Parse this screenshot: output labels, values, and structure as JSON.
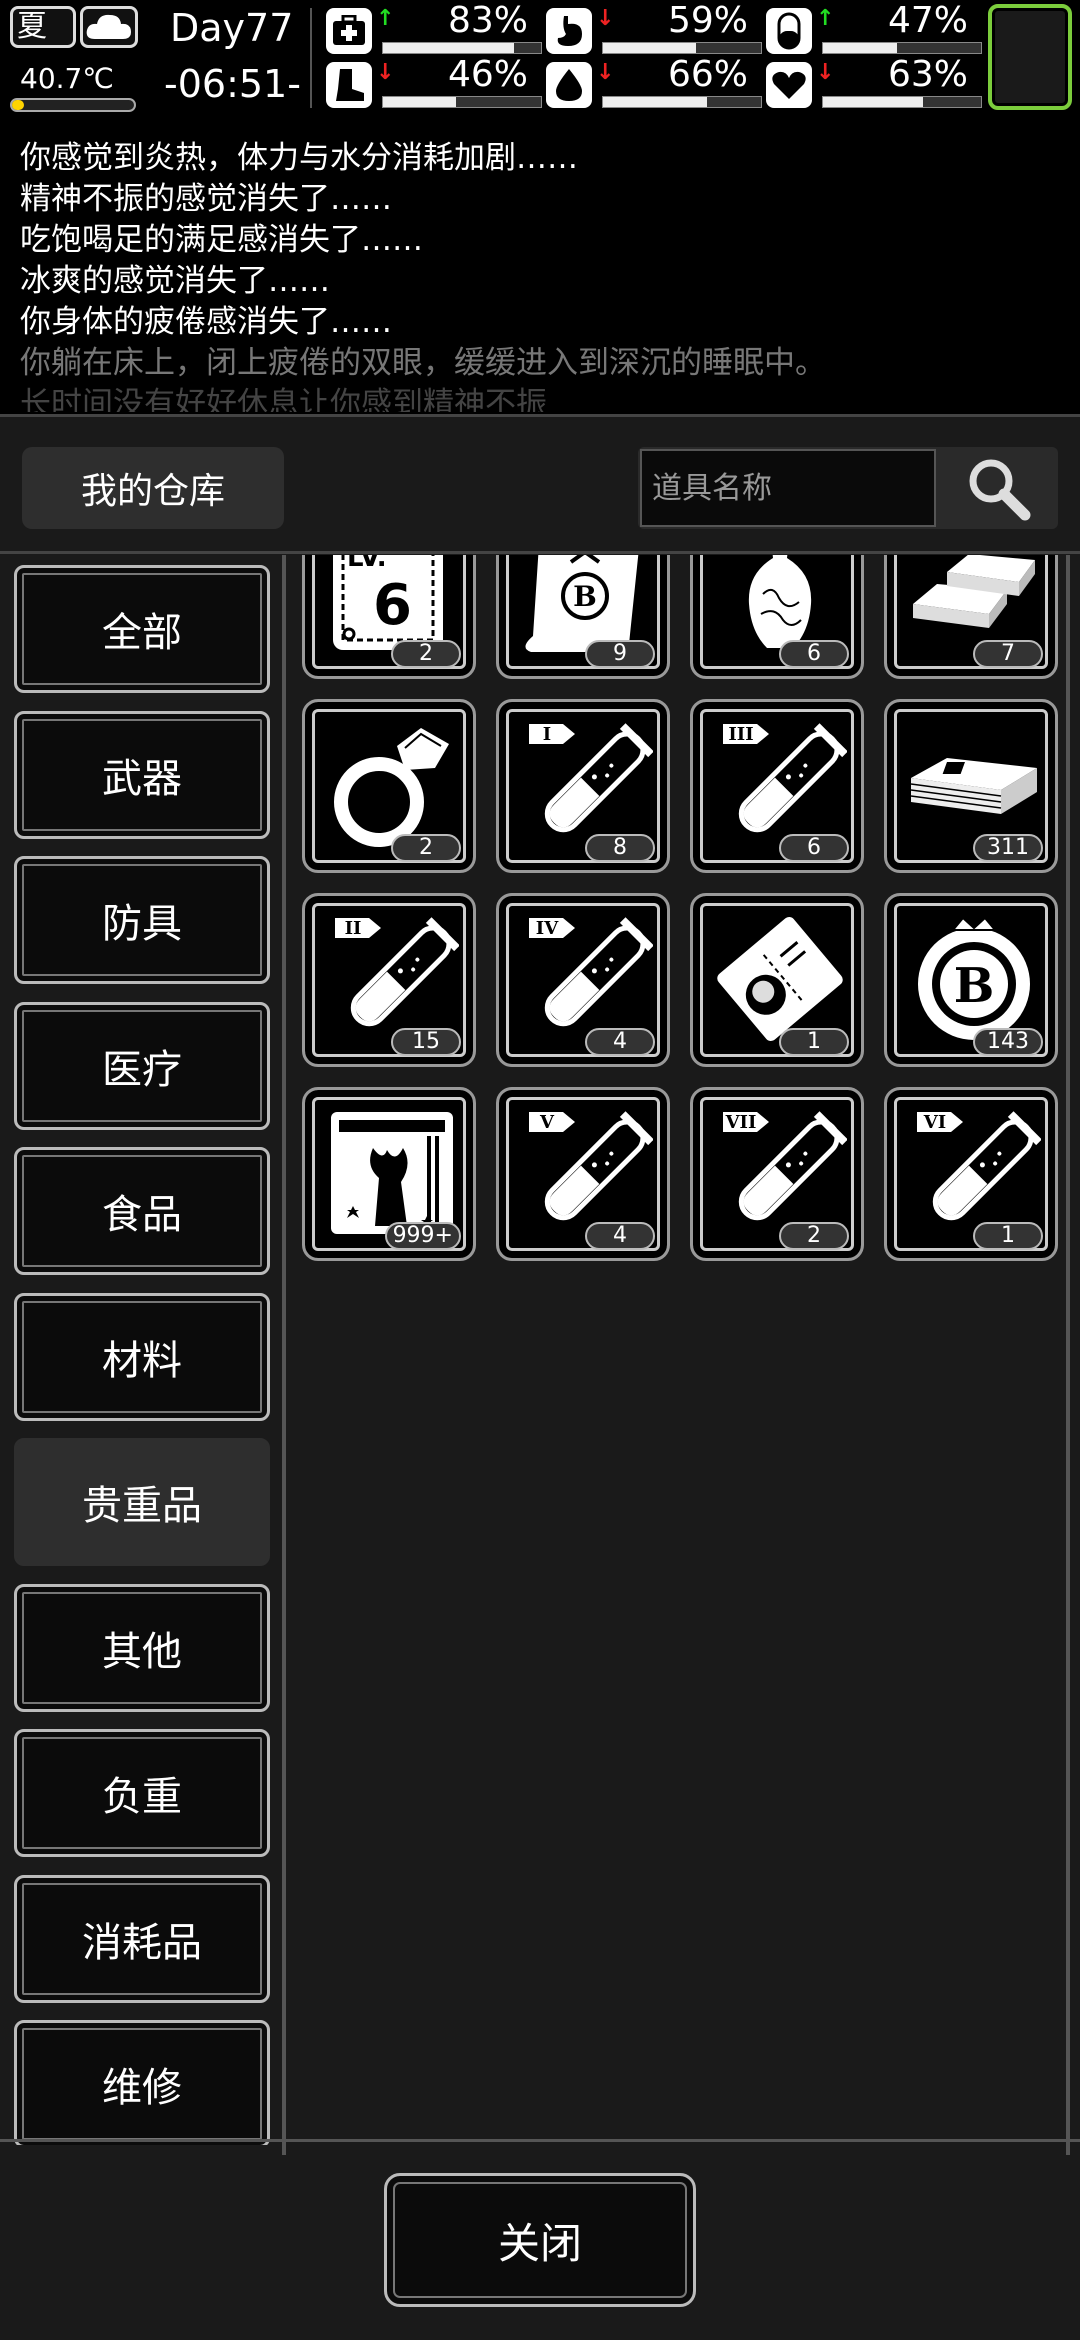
{
  "status": {
    "season": "夏",
    "temperature": "40.7℃",
    "temperature_level": 0.1,
    "day": "Day77",
    "time": "-06:51-",
    "stats": [
      {
        "icon": "medkit-icon",
        "trend": "up",
        "value": "83%",
        "level": 0.83
      },
      {
        "icon": "stomach-icon",
        "trend": "down",
        "value": "59%",
        "level": 0.59
      },
      {
        "icon": "pill-icon",
        "trend": "up",
        "value": "47%",
        "level": 0.47
      },
      {
        "icon": "foot-icon",
        "trend": "down",
        "value": "46%",
        "level": 0.46
      },
      {
        "icon": "water-drop-icon",
        "trend": "down",
        "value": "66%",
        "level": 0.66
      },
      {
        "icon": "heart-icon",
        "trend": "down",
        "value": "63%",
        "level": 0.63
      }
    ],
    "colors": {
      "up": "#22dd22",
      "down": "#ee2222",
      "slot_border": "#7ccd3c",
      "temp_fill": "#ffd400"
    }
  },
  "log": [
    "你感觉到炎热，体力与水分消耗加剧……",
    "精神不振的感觉消失了……",
    "吃饱喝足的满足感消失了……",
    "冰爽的感觉消失了……",
    "你身体的疲倦感消失了……",
    "你躺在床上，闭上疲倦的双眼，缓缓进入到深沉的睡眠中。",
    "长时间没有好好休息让你感到精神不振"
  ],
  "warehouse": {
    "title": "我的仓库",
    "search_placeholder": "道具名称"
  },
  "categories": [
    "全部",
    "武器",
    "防具",
    "医疗",
    "食品",
    "材料",
    "贵重品",
    "其他",
    "负重",
    "消耗品",
    "维修"
  ],
  "active_category": "贵重品",
  "items": [
    {
      "icon": "level-6-card-icon",
      "count": "2"
    },
    {
      "icon": "bitcoin-scroll-icon",
      "count": "9"
    },
    {
      "icon": "vase-icon",
      "count": "6"
    },
    {
      "icon": "gold-bars-icon",
      "count": "7"
    },
    {
      "icon": "diamond-ring-icon",
      "count": "2"
    },
    {
      "icon": "potion-tube-i-icon",
      "count": "8"
    },
    {
      "icon": "potion-tube-iii-icon",
      "count": "6"
    },
    {
      "icon": "cash-stack-icon",
      "count": "311"
    },
    {
      "icon": "potion-tube-ii-icon",
      "count": "15"
    },
    {
      "icon": "potion-tube-iv-icon",
      "count": "4"
    },
    {
      "icon": "id-ticket-icon",
      "count": "1"
    },
    {
      "icon": "bitcoin-coin-icon",
      "count": "143"
    },
    {
      "icon": "zombie-card-icon",
      "count": "999+"
    },
    {
      "icon": "potion-tube-v-icon",
      "count": "4"
    },
    {
      "icon": "potion-tube-vii-icon",
      "count": "2"
    },
    {
      "icon": "potion-tube-vi-icon",
      "count": "1"
    }
  ],
  "tube_labels": {
    "5": "I",
    "6": "III",
    "8": "II",
    "9": "IV",
    "13": "V",
    "14": "VII",
    "15": "VI"
  },
  "close_label": "关闭"
}
